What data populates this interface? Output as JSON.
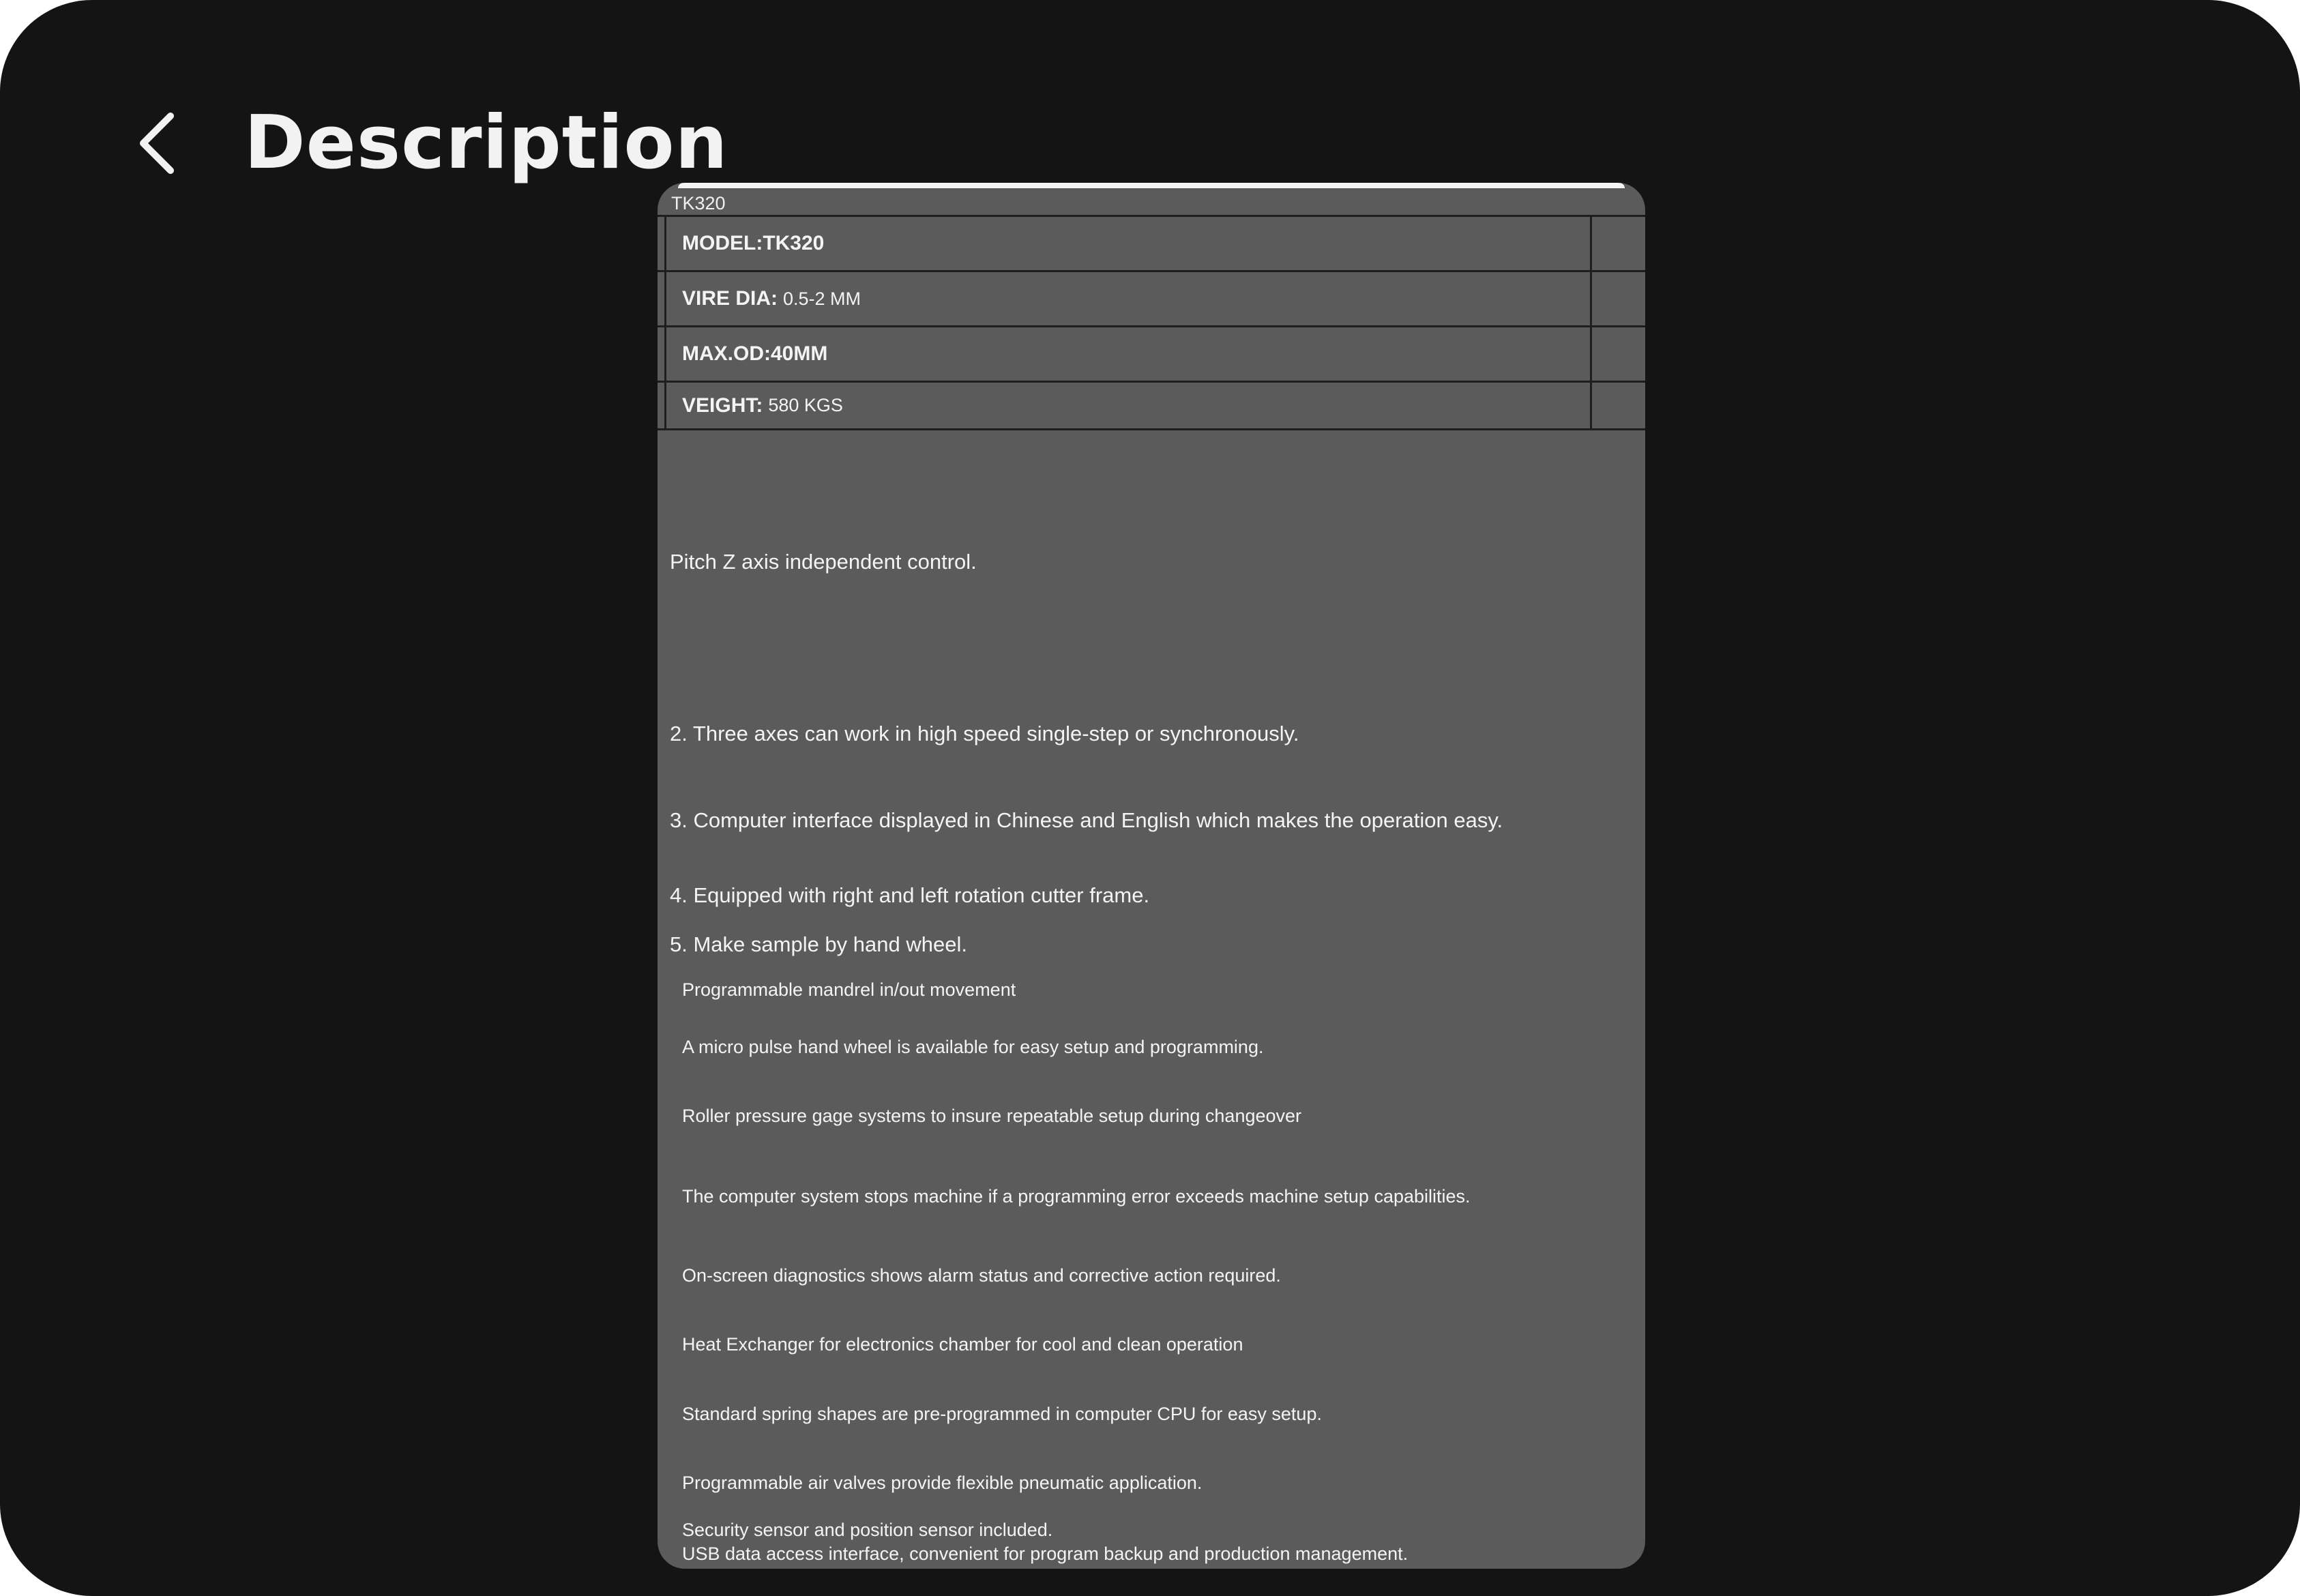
{
  "header": {
    "title": "Description",
    "back_icon": "chevron-left-icon"
  },
  "card": {
    "header_label": "TK320",
    "specs": [
      {
        "label": "MODEL:TK320",
        "value": ""
      },
      {
        "label": "VIRE DIA:",
        "value": "0.5-2 MM"
      },
      {
        "label": "MAX.OD:40MM",
        "value": ""
      },
      {
        "label": "VEIGHT:",
        "value": "580 KGS"
      }
    ],
    "numbered_lines": [
      "Pitch Z axis independent control.",
      "2. Three axes can work in high speed single-step or synchronously.",
      "3. Computer interface displayed in Chinese and English which makes the operation easy.",
      "4. Equipped with right and left rotation cutter frame.",
      "5. Make sample by hand wheel."
    ],
    "features": [
      "Programmable mandrel in/out movement",
      "A micro pulse hand wheel is available for easy setup and programming.",
      "Roller pressure gage systems to insure repeatable setup during changeover",
      "The computer system stops machine if a programming error exceeds machine setup capabilities.",
      "On-screen diagnostics shows alarm status and corrective action required.",
      "Heat Exchanger for electronics chamber for cool and clean operation",
      "Standard spring shapes are pre-programmed in computer CPU for easy setup.",
      "Programmable air valves provide flexible pneumatic application.",
      "Security sensor and position sensor included.",
      "USB data access interface, convenient for program backup and production management."
    ]
  },
  "colors": {
    "background": "#141414",
    "card": "#5b5b5b",
    "text": "#f4f4f4",
    "grid": "#1e1e1e"
  }
}
